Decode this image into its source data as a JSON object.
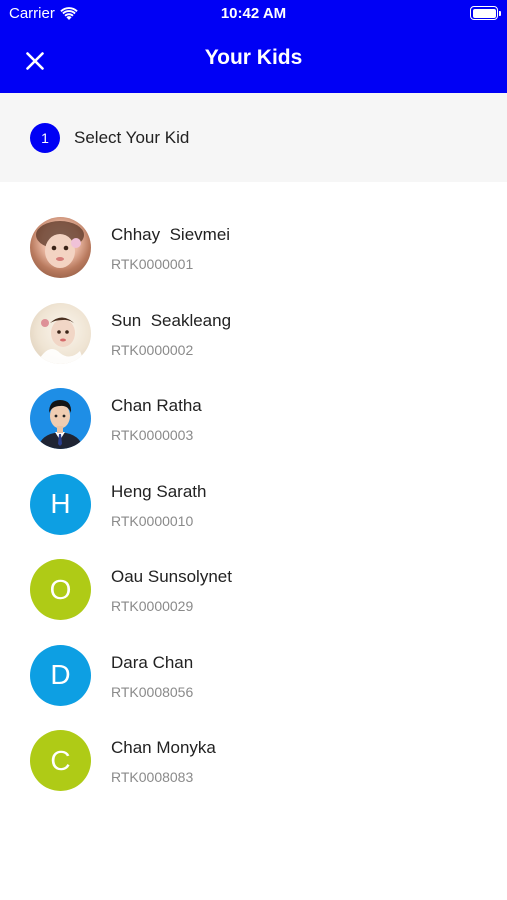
{
  "status_bar": {
    "carrier": "Carrier",
    "time": "10:42 AM"
  },
  "header": {
    "title": "Your Kids",
    "close_icon": "close-icon"
  },
  "step": {
    "number": "1",
    "label": "Select Your Kid"
  },
  "colors": {
    "primary": "#0000f5",
    "initial_blue": "#0d9fe3",
    "initial_green": "#afcb16"
  },
  "kids": [
    {
      "name": "Chhay  Sievmei",
      "id": "RTK0000001",
      "avatar_type": "photo"
    },
    {
      "name": "Sun  Seakleang",
      "id": "RTK0000002",
      "avatar_type": "photo"
    },
    {
      "name": "Chan Ratha",
      "id": "RTK0000003",
      "avatar_type": "photo"
    },
    {
      "name": "Heng Sarath",
      "id": "RTK0000010",
      "initial": "H",
      "color": "#0d9fe3"
    },
    {
      "name": "Oau Sunsolynet",
      "id": "RTK0000029",
      "initial": "O",
      "color": "#afcb16"
    },
    {
      "name": "Dara Chan",
      "id": "RTK0008056",
      "initial": "D",
      "color": "#0d9fe3"
    },
    {
      "name": "Chan Monyka",
      "id": "RTK0008083",
      "initial": "C",
      "color": "#afcb16"
    }
  ]
}
